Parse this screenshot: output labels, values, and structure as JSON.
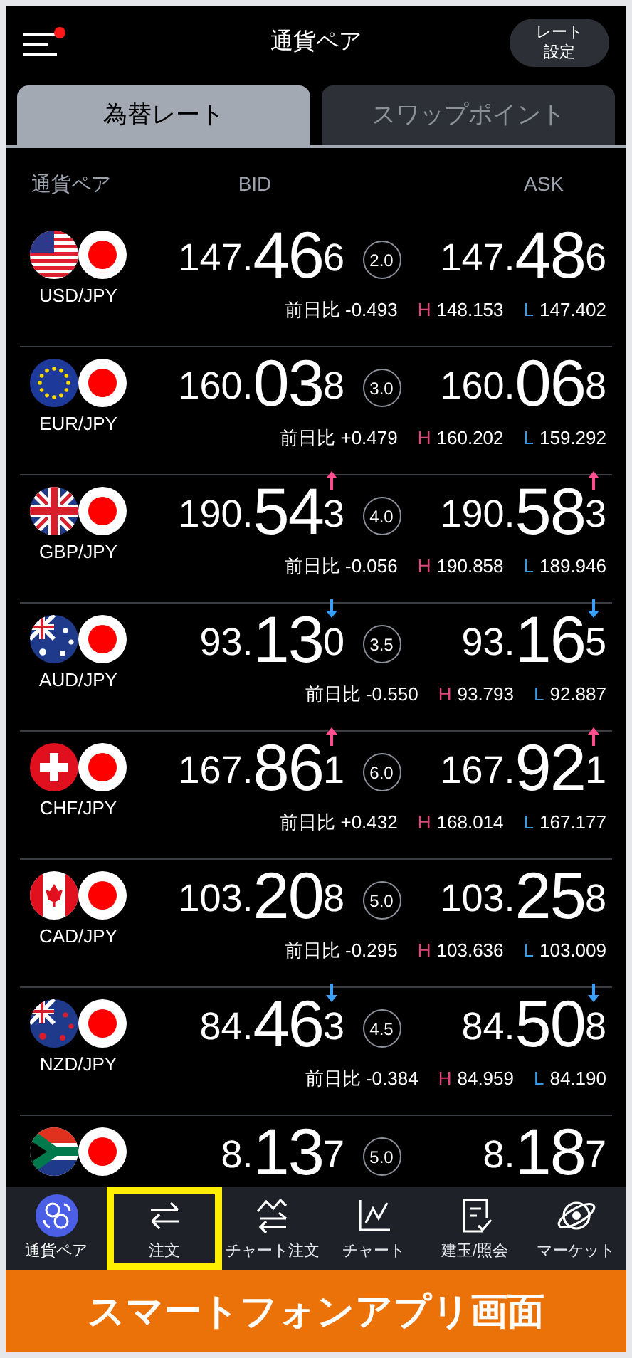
{
  "header": {
    "title": "通貨ペア",
    "menu_badge": true,
    "rate_button": [
      "レート",
      "設定"
    ]
  },
  "tabs": [
    {
      "label": "為替レート",
      "selected": true
    },
    {
      "label": "スワップポイント",
      "selected": false
    }
  ],
  "columns": [
    "通貨ペア",
    "BID",
    "ASK"
  ],
  "rates": [
    {
      "pair": "USD/JPY",
      "kind": "us",
      "arrow_up": false,
      "arrow_down": false,
      "bid": {
        "pre": "147.",
        "big": "46",
        "last": "6"
      },
      "spread": "2.0",
      "ask": {
        "pre": "147.",
        "big": "48",
        "last": "6"
      },
      "change_label": "前日比",
      "change": "-0.493",
      "high_label": "H",
      "high": "148.153",
      "low_label": "L",
      "low": "147.402"
    },
    {
      "pair": "EUR/JPY",
      "kind": "eu",
      "arrow_up": false,
      "arrow_down": false,
      "bid": {
        "pre": "160.",
        "big": "03",
        "last": "8"
      },
      "spread": "3.0",
      "ask": {
        "pre": "160.",
        "big": "06",
        "last": "8"
      },
      "change_label": "前日比",
      "change": "+0.479",
      "high_label": "H",
      "high": "160.202",
      "low_label": "L",
      "low": "159.292"
    },
    {
      "pair": "GBP/JPY",
      "kind": "gb",
      "arrow_up": true,
      "arrow_down": false,
      "bid": {
        "pre": "190.",
        "big": "54",
        "last": "3"
      },
      "spread": "4.0",
      "ask": {
        "pre": "190.",
        "big": "58",
        "last": "3"
      },
      "change_label": "前日比",
      "change": "-0.056",
      "high_label": "H",
      "high": "190.858",
      "low_label": "L",
      "low": "189.946"
    },
    {
      "pair": "AUD/JPY",
      "kind": "au",
      "arrow_up": false,
      "arrow_down": true,
      "bid": {
        "pre": "93.",
        "big": "13",
        "last": "0"
      },
      "spread": "3.5",
      "ask": {
        "pre": "93.",
        "big": "16",
        "last": "5"
      },
      "change_label": "前日比",
      "change": "-0.550",
      "high_label": "H",
      "high": "93.793",
      "low_label": "L",
      "low": "92.887"
    },
    {
      "pair": "CHF/JPY",
      "kind": "ch",
      "arrow_up": true,
      "arrow_down": false,
      "bid": {
        "pre": "167.",
        "big": "86",
        "last": "1"
      },
      "spread": "6.0",
      "ask": {
        "pre": "167.",
        "big": "92",
        "last": "1"
      },
      "change_label": "前日比",
      "change": "+0.432",
      "high_label": "H",
      "high": "168.014",
      "low_label": "L",
      "low": "167.177"
    },
    {
      "pair": "CAD/JPY",
      "kind": "ca",
      "arrow_up": false,
      "arrow_down": false,
      "bid": {
        "pre": "103.",
        "big": "20",
        "last": "8"
      },
      "spread": "5.0",
      "ask": {
        "pre": "103.",
        "big": "25",
        "last": "8"
      },
      "change_label": "前日比",
      "change": "-0.295",
      "high_label": "H",
      "high": "103.636",
      "low_label": "L",
      "low": "103.009"
    },
    {
      "pair": "NZD/JPY",
      "kind": "nz",
      "arrow_up": false,
      "arrow_down": true,
      "bid": {
        "pre": "84.",
        "big": "46",
        "last": "3"
      },
      "spread": "4.5",
      "ask": {
        "pre": "84.",
        "big": "50",
        "last": "8"
      },
      "change_label": "前日比",
      "change": "-0.384",
      "high_label": "H",
      "high": "84.959",
      "low_label": "L",
      "low": "84.190"
    },
    {
      "kind": "za",
      "arrow_up": false,
      "arrow_down": false,
      "bid": {
        "pre": "8.",
        "big": "13",
        "last": "7"
      },
      "spread": "5.0",
      "ask": {
        "pre": "8.",
        "big": "18",
        "last": "7"
      }
    }
  ],
  "nav": [
    {
      "label": "通貨ペア",
      "kind": "pairs",
      "selected": true,
      "highlighted": false
    },
    {
      "label": "注文",
      "kind": "order",
      "selected": false,
      "highlighted": true
    },
    {
      "label": "チャート注文",
      "kind": "chart-order",
      "selected": false,
      "highlighted": false
    },
    {
      "label": "チャート",
      "kind": "chart",
      "selected": false,
      "highlighted": false
    },
    {
      "label": "建玉/照会",
      "kind": "positions",
      "selected": false,
      "highlighted": false
    },
    {
      "label": "マーケット",
      "kind": "market",
      "selected": false,
      "highlighted": false
    }
  ],
  "banner": "スマートフォンアプリ画面"
}
